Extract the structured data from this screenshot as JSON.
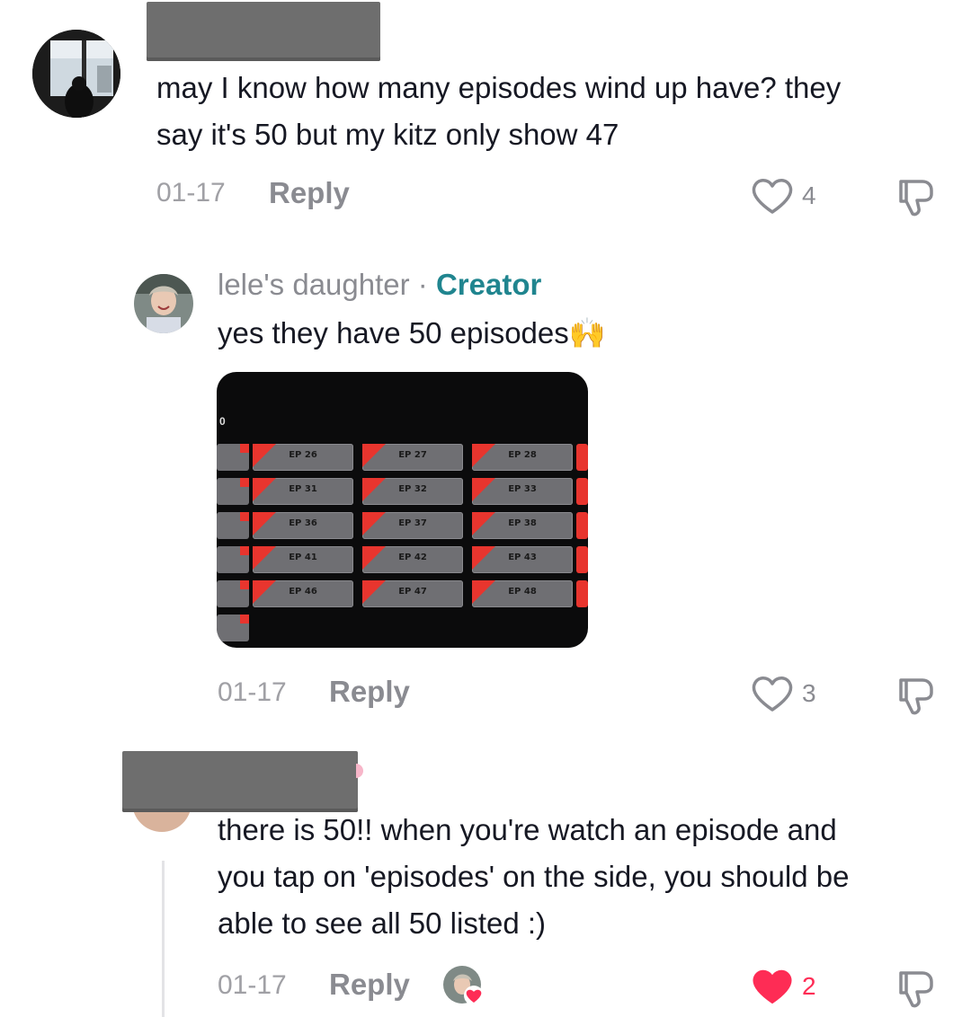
{
  "comments": [
    {
      "text": "may I know how many episodes wind up have? they say it's 50 but my kitz only show 47",
      "line1": "may I know how many episodes wind up have? they",
      "line2": "say it's 50 but my kitz only show 47",
      "date": "01-17",
      "reply_label": "Reply",
      "likes": "4",
      "liked": false
    },
    {
      "author": "lele's daughter",
      "separator": "·",
      "badge": "Creator",
      "text": "yes they have 50 episodes🙌",
      "date": "01-17",
      "reply_label": "Reply",
      "likes": "3",
      "liked": false,
      "image_episodes": [
        [
          "EP 26",
          "EP 27",
          "EP 28"
        ],
        [
          "EP 31",
          "EP 32",
          "EP 33"
        ],
        [
          "EP 36",
          "EP 37",
          "EP 38"
        ],
        [
          "EP 41",
          "EP 42",
          "EP 43"
        ],
        [
          "EP 46",
          "EP 47",
          "EP 48"
        ]
      ]
    },
    {
      "line1": "there is 50!! when you're watch an episode and",
      "line2": "you tap on 'episodes' on the side, you should be",
      "line3": "able to see all 50 listed :)",
      "date": "01-17",
      "reply_label": "Reply",
      "likes": "2",
      "liked": true
    }
  ],
  "colors": {
    "creator_badge": "#20858f",
    "liked_heart": "#fe2c55",
    "muted_text": "#8a8b91",
    "redaction": "#6e6e6e"
  },
  "icons": [
    "heart-icon",
    "dislike-thumb-icon",
    "creator-liked-avatar-icon"
  ]
}
